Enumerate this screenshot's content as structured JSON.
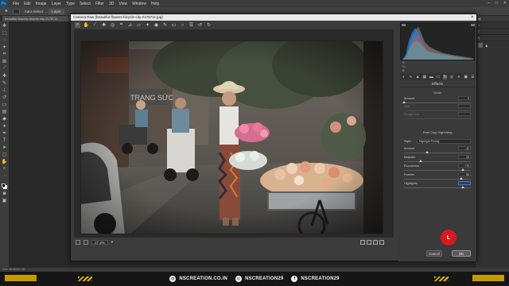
{
  "menu": {
    "app_logo": "Ps",
    "items": [
      "File",
      "Edit",
      "Image",
      "Layer",
      "Type",
      "Select",
      "Filter",
      "3D",
      "View",
      "Window",
      "Help"
    ],
    "window_controls": [
      "–",
      "□",
      "✕"
    ]
  },
  "options_bar": {
    "auto_select_label": "Auto-Select:",
    "layer_value": "Layer"
  },
  "document_tab": "beautiful-flowers-bicycle-city-2175711...",
  "camera_raw": {
    "title": "Camera Raw (beautiful-flowers-bicycle-city-2175711.jpg)",
    "zoom_level": "27.2%",
    "panel_title": "Effects",
    "grain": {
      "title": "Grain",
      "sliders": [
        {
          "label": "Amount",
          "value": "0",
          "fraction": 0.0,
          "enabled": true
        },
        {
          "label": "Size",
          "value": "",
          "fraction": 0.25,
          "enabled": false
        },
        {
          "label": "Roughness",
          "value": "",
          "fraction": 0.5,
          "enabled": false
        }
      ]
    },
    "vignetting": {
      "title": "Post Crop Vignetting",
      "style_label": "Style:",
      "style_value": "Highlight Priority",
      "sliders": [
        {
          "label": "Amount",
          "value": "-32",
          "fraction": 0.34
        },
        {
          "label": "Midpoint",
          "value": "25",
          "fraction": 0.25
        },
        {
          "label": "Roundness",
          "value": "+75",
          "fraction": 0.875
        },
        {
          "label": "Feather",
          "value": "86",
          "fraction": 0.86
        },
        {
          "label": "Highlights",
          "value": "",
          "fraction": 0.88
        }
      ]
    },
    "histogram_info": [
      "R:",
      "G:",
      "B:"
    ],
    "cancel_label": "Cancel",
    "ok_label": "OK"
  },
  "record_badge": "L",
  "status_bar": "Doc: 48.6M/57.2M",
  "footer": {
    "website": "NSCREATION.CO.IN",
    "instagram": "NSCREATION29",
    "facebook": "NSCREATION29"
  },
  "colors": {
    "record_red": "#d8191d",
    "footer_accent": "#e8b400",
    "dialog_bg": "#3b3b3b"
  }
}
